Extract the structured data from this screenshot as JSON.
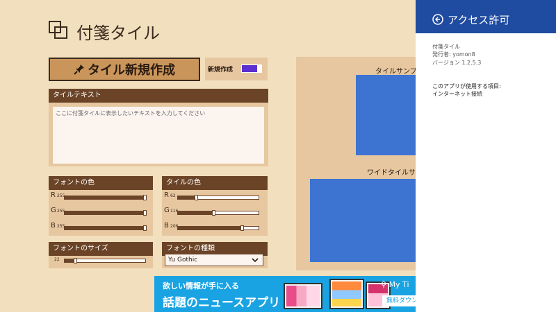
{
  "app": {
    "title": "付箋タイル"
  },
  "toolbar": {
    "new_tile_label": "タイル新規作成",
    "new_toggle_label": "新規作成"
  },
  "text_panel": {
    "header": "タイルテキスト",
    "placeholder": "ここに付箋タイルに表示したいテキストを入力してください"
  },
  "font_color": {
    "header": "フォントの色",
    "channels": [
      {
        "letter": "R",
        "value": "255",
        "level": 1.0
      },
      {
        "letter": "G",
        "value": "255",
        "level": 1.0
      },
      {
        "letter": "B",
        "value": "255",
        "level": 1.0
      }
    ]
  },
  "tile_color": {
    "header": "タイルの色",
    "channels": [
      {
        "letter": "R",
        "value": "62",
        "level": 0.243
      },
      {
        "letter": "G",
        "value": "116",
        "level": 0.455
      },
      {
        "letter": "B",
        "value": "206",
        "level": 0.808
      }
    ]
  },
  "font_size": {
    "header": "フォントのサイズ",
    "value": "22",
    "level": 0.15
  },
  "font_type": {
    "header": "フォントの種類",
    "selected": "Yu Gothic"
  },
  "samples": {
    "tile_label": "タイルサンプル",
    "wide_label": "ワイドタイルサン"
  },
  "ad": {
    "line1": "欲しい情報が手に入る",
    "line2": "話題のニュースアプリ",
    "brand": "My Ti",
    "download": "無料ダウン"
  },
  "charm": {
    "title": "アクセス許可",
    "app_name": "付箋タイル",
    "publisher": "発行者: yomon8",
    "version": "バージョン 1.2.5.3",
    "uses_label": "このアプリが使用する項目:",
    "uses_item": "インターネット接続"
  },
  "colors": {
    "background": "#f2dfbd",
    "header_brown": "#6b4427",
    "panel": "#e6c7a0",
    "tile_blue": "#3d74d1",
    "charm_blue": "#1f4ba0",
    "ad_blue": "#1aa3e3",
    "toggle_purple": "#5b2fd1"
  },
  "icons": {
    "logo": "overlapping-squares-icon",
    "pin": "pin-icon",
    "chevron": "chevron-down-icon",
    "back": "back-arrow-circle-icon"
  }
}
